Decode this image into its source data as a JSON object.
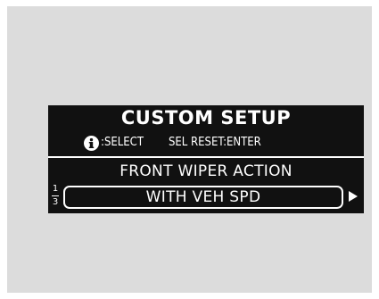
{
  "screen": {
    "title": "CUSTOM SETUP",
    "hint_select": ":SELECT",
    "hint_enter": "SEL RESET:ENTER"
  },
  "menu": {
    "item_title": "FRONT WIPER ACTION",
    "selected_option": "WITH VEH SPD",
    "page_current": "1",
    "page_total": "3",
    "next_icon": "right-triangle-icon"
  },
  "icons": {
    "info": "info-icon"
  },
  "colors": {
    "display_bg": "#111111",
    "display_fg": "#ffffff",
    "panel_bg": "#dcdcdc"
  }
}
